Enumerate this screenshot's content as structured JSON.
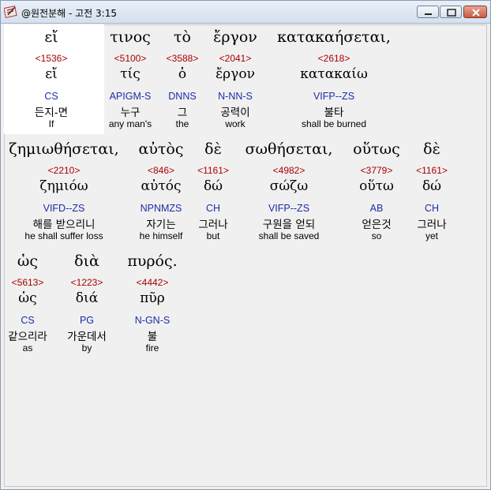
{
  "window": {
    "title": "@원전분해 - 고전 3:15",
    "controls": {
      "minimize_icon": "minimize-icon",
      "maximize_icon": "maximize-icon",
      "close_icon": "close-icon"
    },
    "app_icon": "app-icon"
  },
  "words": [
    {
      "greek": "εἴ",
      "strong": "<1536>",
      "lemma": "εἴ",
      "morph": "CS",
      "korean": "든지-면",
      "english": "If"
    },
    {
      "greek": "τινος",
      "strong": "<5100>",
      "lemma": "τίς",
      "morph": "APIGM-S",
      "korean": "누구",
      "english": "any man's"
    },
    {
      "greek": "τὸ",
      "strong": "<3588>",
      "lemma": "ὁ",
      "morph": "DNNS",
      "korean": "그",
      "english": "the"
    },
    {
      "greek": "ἔργον",
      "strong": "<2041>",
      "lemma": "ἔργον",
      "morph": "N-NN-S",
      "korean": "공력이",
      "english": "work"
    },
    {
      "greek": "κατακαήσεται,",
      "strong": "<2618>",
      "lemma": "κατακαίω",
      "morph": "VIFP--ZS",
      "korean": "불타",
      "english": "shall be burned"
    },
    {
      "greek": "ζημιωθήσεται,",
      "strong": "<2210>",
      "lemma": "ζημιόω",
      "morph": "VIFD--ZS",
      "korean": "해를 받으리니",
      "english": "he shall suffer loss"
    },
    {
      "greek": "αὐτὸς",
      "strong": "<846>",
      "lemma": "αὐτός",
      "morph": "NPNMZS",
      "korean": "자기는",
      "english": "he himself"
    },
    {
      "greek": "δὲ",
      "strong": "<1161>",
      "lemma": "δώ",
      "morph": "CH",
      "korean": "그러나",
      "english": "but"
    },
    {
      "greek": "σωθήσεται,",
      "strong": "<4982>",
      "lemma": "σώζω",
      "morph": "VIFP--ZS",
      "korean": "구원을 얻되",
      "english": "shall be saved"
    },
    {
      "greek": "οὕτως",
      "strong": "<3779>",
      "lemma": "οὕτω",
      "morph": "AB",
      "korean": "얻은것",
      "english": "so"
    },
    {
      "greek": "δὲ",
      "strong": "<1161>",
      "lemma": "δώ",
      "morph": "CH",
      "korean": "그러나",
      "english": "yet"
    },
    {
      "greek": "ὡς",
      "strong": "<5613>",
      "lemma": "ὡς",
      "morph": "CS",
      "korean": "같으리라",
      "english": "as"
    },
    {
      "greek": "διὰ",
      "strong": "<1223>",
      "lemma": "διά",
      "morph": "PG",
      "korean": "가운데서",
      "english": "by"
    },
    {
      "greek": "πυρός.",
      "strong": "<4442>",
      "lemma": "πῦρ",
      "morph": "N-GN-S",
      "korean": "불",
      "english": "fire"
    }
  ]
}
